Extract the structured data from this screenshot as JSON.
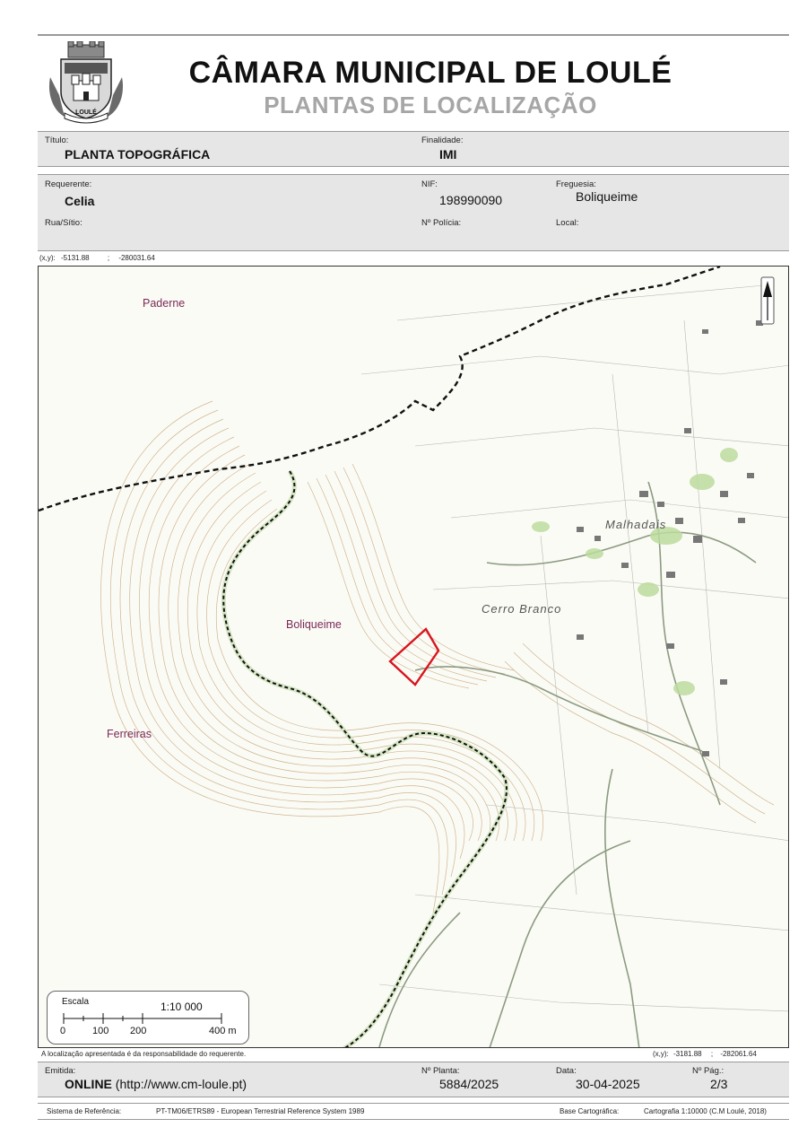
{
  "header": {
    "logo_text": "LOULÉ",
    "title": "CÂMARA MUNICIPAL DE LOULÉ",
    "subtitle": "PLANTAS DE LOCALIZAÇÃO"
  },
  "form": {
    "titulo_label": "Título:",
    "titulo_value": "PLANTA TOPOGRÁFICA",
    "finalidade_label": "Finalidade:",
    "finalidade_value": "IMI",
    "requerente_label": "Requerente:",
    "requerente_value": "Celia",
    "nif_label": "NIF:",
    "nif_value": "198990090",
    "freguesia_label": "Freguesia:",
    "freguesia_value": "Boliqueime",
    "rua_label": "Rua/Sítio:",
    "policia_label": "Nº Polícia:",
    "local_label": "Local:"
  },
  "coords_top": {
    "label": "(x,y):",
    "x": "-5131.88",
    "sep": ";",
    "y": "-280031.64"
  },
  "map": {
    "places": [
      "Paderne",
      "Boliqueime",
      "Ferreiras"
    ],
    "localities": [
      "Malhadais",
      "Cerro Branco"
    ]
  },
  "scale": {
    "label": "Escala",
    "ratio": "1:10 000",
    "ticks": [
      "0",
      "100",
      "200",
      "400 m"
    ]
  },
  "bottom_note": "A localização apresentada é da responsabilidade do requerente.",
  "coords_bottom": {
    "label": "(x,y):",
    "x": "-3181.88",
    "sep": ";",
    "y": "-282061.64"
  },
  "footer": {
    "emitida_label": "Emitida:",
    "emitida_bold": "ONLINE",
    "emitida_rest": " (http://www.cm-loule.pt)",
    "planta_label": "Nº Planta:",
    "planta_value": "5884/2025",
    "data_label": "Data:",
    "data_value": "30-04-2025",
    "pag_label": "Nº Pág.:",
    "pag_value": "2/3",
    "sistema_label": "Sistema de Referência:",
    "sistema_value": "PT-TM06/ETRS89 - European Terrestrial Reference System 1989",
    "base_label": "Base Cartográfica:",
    "base_value": "Cartografia 1:10000 (C.M Loulé, 2018)"
  },
  "colors": {
    "contour": "#c9b08a",
    "road": "#8a9a7a",
    "boundary": "#111111",
    "green": "#b9d99a",
    "parcel": "#d8151f",
    "place_text": "#7a2a55"
  }
}
